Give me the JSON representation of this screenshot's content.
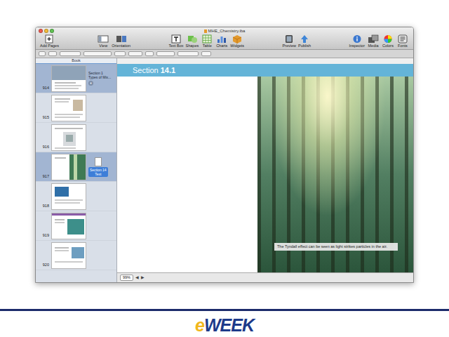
{
  "window": {
    "title": "MHE_Chemistry.iba"
  },
  "toolbar": {
    "groups": [
      {
        "items": [
          {
            "label": "Add Pages"
          }
        ]
      },
      {
        "items": [
          {
            "label": "View"
          },
          {
            "label": "Orientation"
          }
        ]
      },
      {
        "items": [
          {
            "label": "Text Box"
          },
          {
            "label": "Shapes"
          },
          {
            "label": "Table"
          },
          {
            "label": "Charts"
          },
          {
            "label": "Widgets"
          }
        ]
      },
      {
        "items": [
          {
            "label": "Preview"
          },
          {
            "label": "Publish"
          }
        ]
      },
      {
        "items": [
          {
            "label": "Inspector"
          },
          {
            "label": "Media"
          },
          {
            "label": "Colors"
          },
          {
            "label": "Fonts"
          }
        ]
      }
    ]
  },
  "sidebar": {
    "header": "Book",
    "pages": [
      {
        "number": "914",
        "selected": true,
        "title": "Section 1",
        "subtitle": "Types of Mix...",
        "toggle": "▼",
        "expanded": true
      },
      {
        "number": "915",
        "selected": false
      },
      {
        "number": "916",
        "selected": false
      },
      {
        "number": "917",
        "selected": true,
        "drag": {
          "title": "Section 14",
          "subtitle": "Text"
        }
      },
      {
        "number": "918",
        "selected": false
      },
      {
        "number": "919",
        "selected": false
      },
      {
        "number": "920",
        "selected": false
      }
    ]
  },
  "canvas": {
    "section": {
      "prefix": "Section",
      "number": "14.1"
    },
    "caption": "The Tyndall effect can be seen as light strikes particles in the air."
  },
  "status_bar": {
    "zoom": "99%",
    "controls": [
      "◀",
      "▶"
    ]
  },
  "logo": {
    "e": "e",
    "rest": "WEEK"
  }
}
